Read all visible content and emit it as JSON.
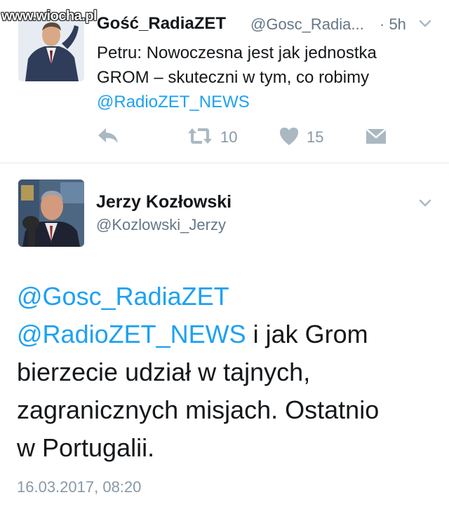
{
  "watermark": "www.wiocha.pl",
  "tweet1": {
    "display_name": "Gość_RadiaZET",
    "handle": "@Gosc_Radia...",
    "time": "· 5h",
    "text_lines": [
      "Petru: Nowoczesna jest jak jednostka",
      "GROM – skuteczni w tym, co robimy"
    ],
    "link": "@RadioZET_NEWS",
    "retweet_count": "10",
    "like_count": "15"
  },
  "tweet2": {
    "display_name": "Jerzy Kozłowski",
    "handle": "@Kozlowski_Jerzy",
    "mention1": "@Gosc_RadiaZET",
    "mention2": "@RadioZET_NEWS",
    "text_after_mention2": " i jak Grom",
    "text_lines": [
      "bierzecie udział w tajnych,",
      "zagranicznych misjach. Ostatnio",
      "w Portugalii."
    ],
    "date": "16.03.2017, 08:20"
  },
  "colors": {
    "link": "#1da1f2",
    "secondary_text": "#657786",
    "action_icon": "#aab8c2"
  },
  "icons": {
    "reply": "reply-icon",
    "retweet": "retweet-icon",
    "like": "heart-icon",
    "dm": "direct-message-icon",
    "more": "chevron-down-icon"
  }
}
